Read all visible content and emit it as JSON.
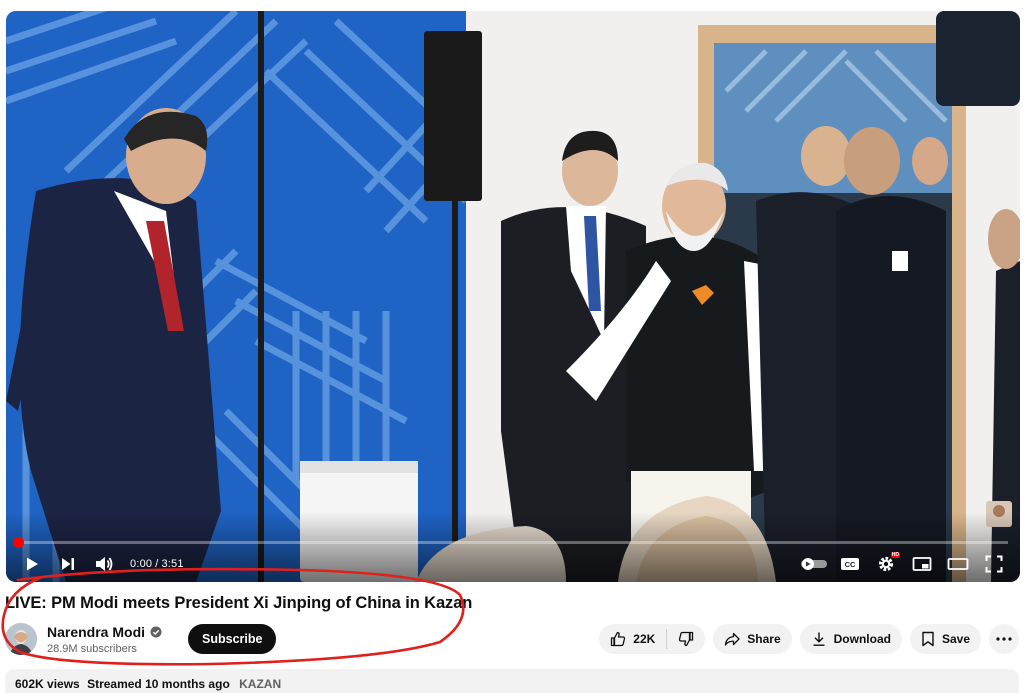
{
  "player": {
    "time_current": "0:00",
    "time_separator": "/",
    "time_total": "3:51",
    "progress": 0.0,
    "hd_badge": "HD",
    "icons": {
      "play": "play-icon",
      "next": "next-icon",
      "volume": "volume-icon",
      "autoplay": "autoplay-toggle-icon",
      "captions": "captions-icon",
      "settings": "gear-icon",
      "miniplayer": "miniplayer-icon",
      "theater": "theater-mode-icon",
      "fullscreen": "fullscreen-icon"
    }
  },
  "video": {
    "title": "LIVE: PM Modi meets President Xi Jinping of China in Kazan"
  },
  "channel": {
    "name": "Narendra Modi",
    "subscribers": "28.9M subscribers",
    "verified_icon": "verified-check-icon",
    "subscribe_label": "Subscribe"
  },
  "actions": {
    "like_count": "22K",
    "share_label": "Share",
    "download_label": "Download",
    "save_label": "Save",
    "icons": {
      "like": "thumb-up-icon",
      "dislike": "thumb-down-icon",
      "share": "share-arrow-icon",
      "download": "download-icon",
      "save": "bookmark-icon",
      "more": "more-horizontal-icon"
    }
  },
  "description": {
    "views": "602K views",
    "streamed": "Streamed 10 months ago",
    "tag": "KAZAN"
  },
  "colors": {
    "brand_red": "#ff0000",
    "annotation_red": "#e0201c",
    "subscribe_bg": "#0f0f0f",
    "pill_bg": "#f2f2f2"
  }
}
